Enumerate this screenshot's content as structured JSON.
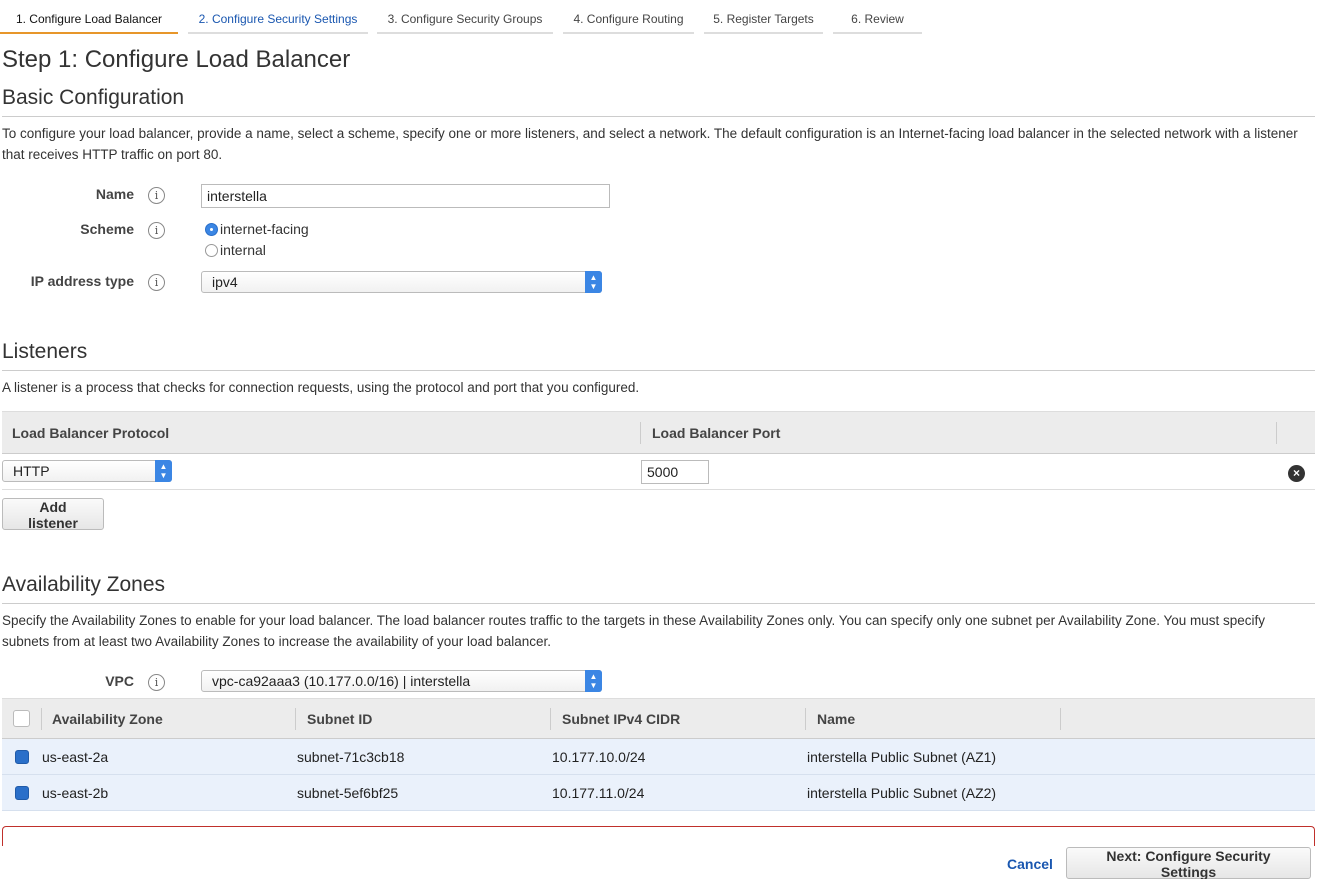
{
  "wizard": {
    "tabs": [
      {
        "label": "1. Configure Load Balancer",
        "active": true
      },
      {
        "label": "2. Configure Security Settings",
        "active": false
      },
      {
        "label": "3. Configure Security Groups",
        "active": false
      },
      {
        "label": "4. Configure Routing",
        "active": false
      },
      {
        "label": "5. Register Targets",
        "active": false
      },
      {
        "label": "6. Review",
        "active": false
      }
    ]
  },
  "page_title": "Step 1: Configure Load Balancer",
  "basic": {
    "heading": "Basic Configuration",
    "description": "To configure your load balancer, provide a name, select a scheme, specify one or more listeners, and select a network. The default configuration is an Internet-facing load balancer in the selected network with a listener that receives HTTP traffic on port 80.",
    "name_label": "Name",
    "name_value": "interstella",
    "scheme_label": "Scheme",
    "scheme_options": [
      "internet-facing",
      "internal"
    ],
    "scheme_selected": "internet-facing",
    "ip_label": "IP address type",
    "ip_value": "ipv4"
  },
  "listeners": {
    "heading": "Listeners",
    "description": "A listener is a process that checks for connection requests, using the protocol and port that you configured.",
    "col_protocol": "Load Balancer Protocol",
    "col_port": "Load Balancer Port",
    "rows": [
      {
        "protocol": "HTTP",
        "port": "5000"
      }
    ],
    "add_label": "Add listener"
  },
  "zones": {
    "heading": "Availability Zones",
    "description": "Specify the Availability Zones to enable for your load balancer. The load balancer routes traffic to the targets in these Availability Zones only. You can specify only one subnet per Availability Zone. You must specify subnets from at least two Availability Zones to increase the availability of your load balancer.",
    "vpc_label": "VPC",
    "vpc_value": "vpc-ca92aaa3 (10.177.0.0/16) | interstella",
    "columns": [
      "Availability Zone",
      "Subnet ID",
      "Subnet IPv4 CIDR",
      "Name"
    ],
    "rows": [
      {
        "zone": "us-east-2a",
        "subnet": "subnet-71c3cb18",
        "cidr": "10.177.10.0/24",
        "name": "interstella Public Subnet (AZ1)",
        "checked": true
      },
      {
        "zone": "us-east-2b",
        "subnet": "subnet-5ef6bf25",
        "cidr": "10.177.11.0/24",
        "name": "interstella Public Subnet (AZ2)",
        "checked": true
      }
    ]
  },
  "footer": {
    "cancel_label": "Cancel",
    "next_label": "Next: Configure Security Settings"
  },
  "icons": {
    "info": "i",
    "remove": "×"
  },
  "colors": {
    "accent_tab": "#e7962a",
    "link": "#1a57b0",
    "select_arrow": "#3b86e4",
    "error_border": "#c0302b"
  }
}
